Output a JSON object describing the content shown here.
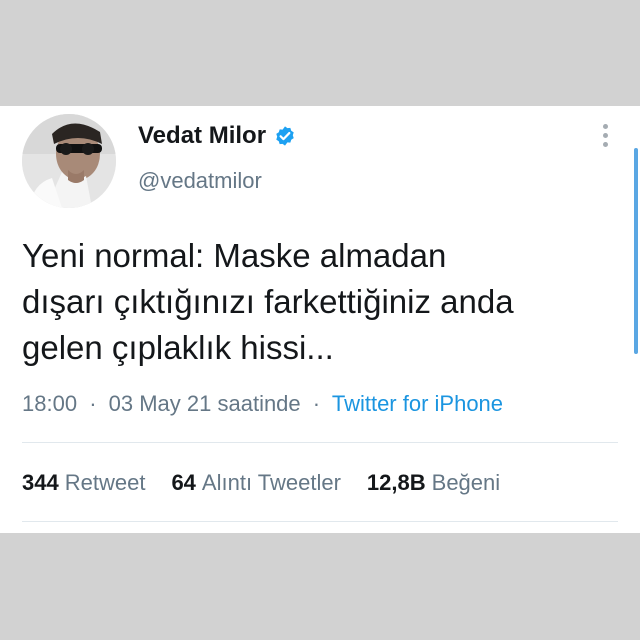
{
  "tweet": {
    "display_name": "Vedat Milor",
    "handle": "@vedatmilor",
    "text": "Yeni normal: Maske almadan\ndışarı çıktığınızı farkettiğiniz anda\ngelen çıplaklık hissi...",
    "time": "18:00",
    "date_text": "03 May 21 saatinde",
    "separator": "·",
    "source": "Twitter for iPhone",
    "source_color": "#1b95e0",
    "icons": {
      "verified": "verified-badge-icon",
      "more": "more-options-icon",
      "avatar": "avatar-photo"
    }
  },
  "stats": {
    "retweets_count": "344",
    "retweets_label": "Retweet",
    "quotes_count": "64",
    "quotes_label": "Alıntı Tweetler",
    "likes_count": "12,8B",
    "likes_label": "Beğeni"
  }
}
